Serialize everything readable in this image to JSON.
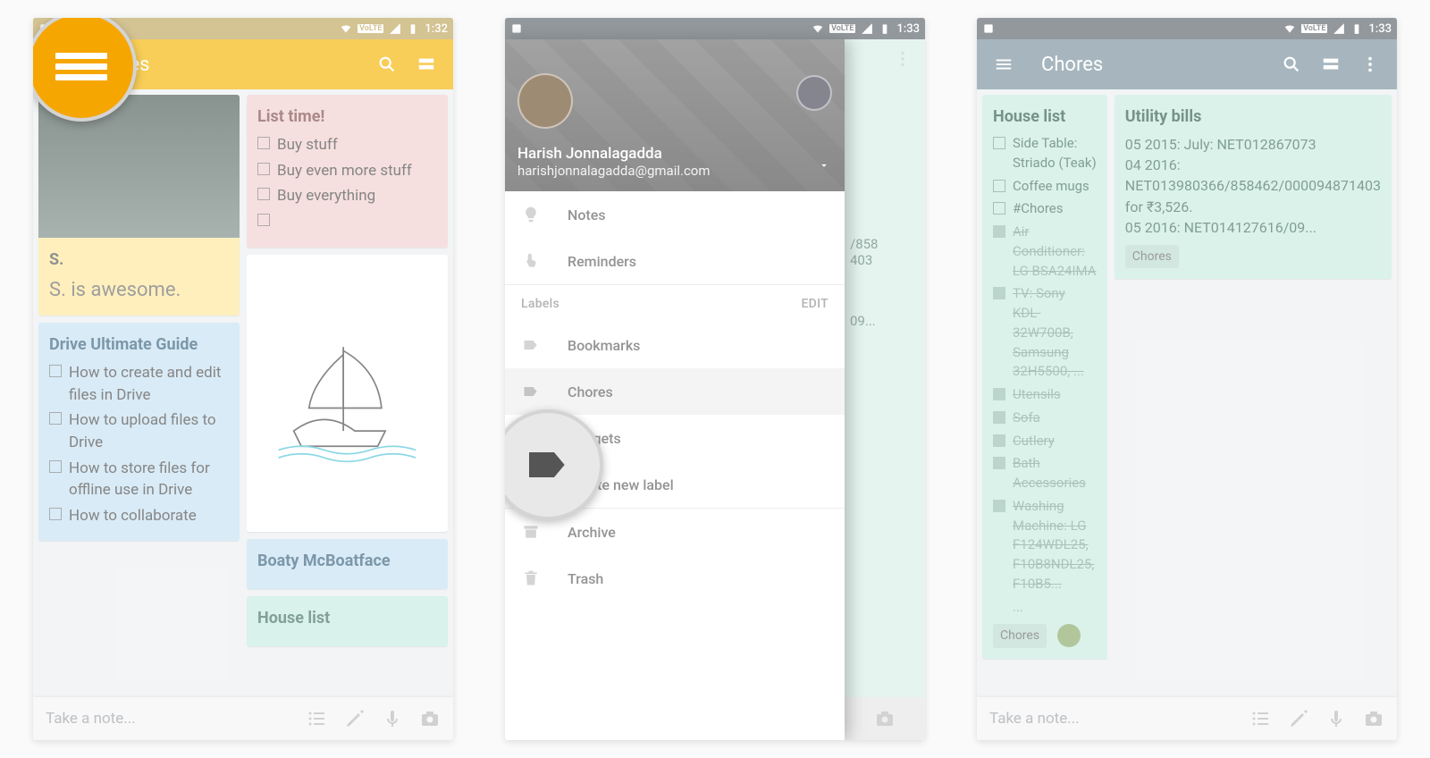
{
  "status": {
    "time1": "1:32",
    "time2": "1:33",
    "time3": "1:33",
    "volte": "VoLTE",
    "battery": "27"
  },
  "p1": {
    "title": "Notes",
    "bottom_hint": "Take a note...",
    "notes": {
      "s_title": "S.",
      "s_body": "S. is awesome.",
      "list_title": "List time!",
      "list_items": [
        "Buy stuff",
        "Buy even more stuff",
        "Buy everything"
      ],
      "drive_title": "Drive Ultimate Guide",
      "drive_items": [
        "How to create and edit files in Drive",
        "How to upload files to Drive",
        "How to store files for offline use in Drive",
        "How to collaborate"
      ],
      "boat_title": "Boaty McBoatface",
      "house_title": "House list"
    }
  },
  "p2": {
    "user_name": "Harish Jonnalagadda",
    "user_email": "harishjonnalagadda@gmail.com",
    "item_notes": "Notes",
    "item_reminders": "Reminders",
    "labels_header": "Labels",
    "labels_edit": "EDIT",
    "label_bookmarks": "Bookmarks",
    "label_chores": "Chores",
    "label_gadgets": "Gadgets",
    "item_create": "Create new label",
    "item_archive": "Archive",
    "item_trash": "Trash",
    "peek1": "/858",
    "peek2": "403",
    "peek3": "09..."
  },
  "p3": {
    "title": "Chores",
    "bottom_hint": "Take a note...",
    "chip": "Chores",
    "house": {
      "title": "House list",
      "unchecked": [
        "Side Table: Striado (Teak)",
        "Coffee mugs",
        "#Chores"
      ],
      "checked": [
        "Air Conditioner: LG BSA24IMA",
        "TV: Sony KDL-32W700B, Samsung 32H5500, ...",
        "Utensils",
        "Sofa",
        "Cutlery",
        "Bath Accessories",
        "Washing Machine: LG F124WDL25, F10B8NDL25, F10B5..."
      ],
      "more": "..."
    },
    "utility": {
      "title": "Utility bills",
      "body": "05 2015: July: NET012867073\n04 2016: NET013980366/858462/000094871403 for ₹3,526.\n05 2016: NET014127616/09..."
    }
  },
  "colors": {
    "keep_yellow": "#f4b400",
    "note_yellow": "#fff59d",
    "note_pink": "#f1cfce",
    "note_blue": "#c5e1f2",
    "note_teal": "#c5ece0",
    "bluegrey": "#78909c"
  }
}
